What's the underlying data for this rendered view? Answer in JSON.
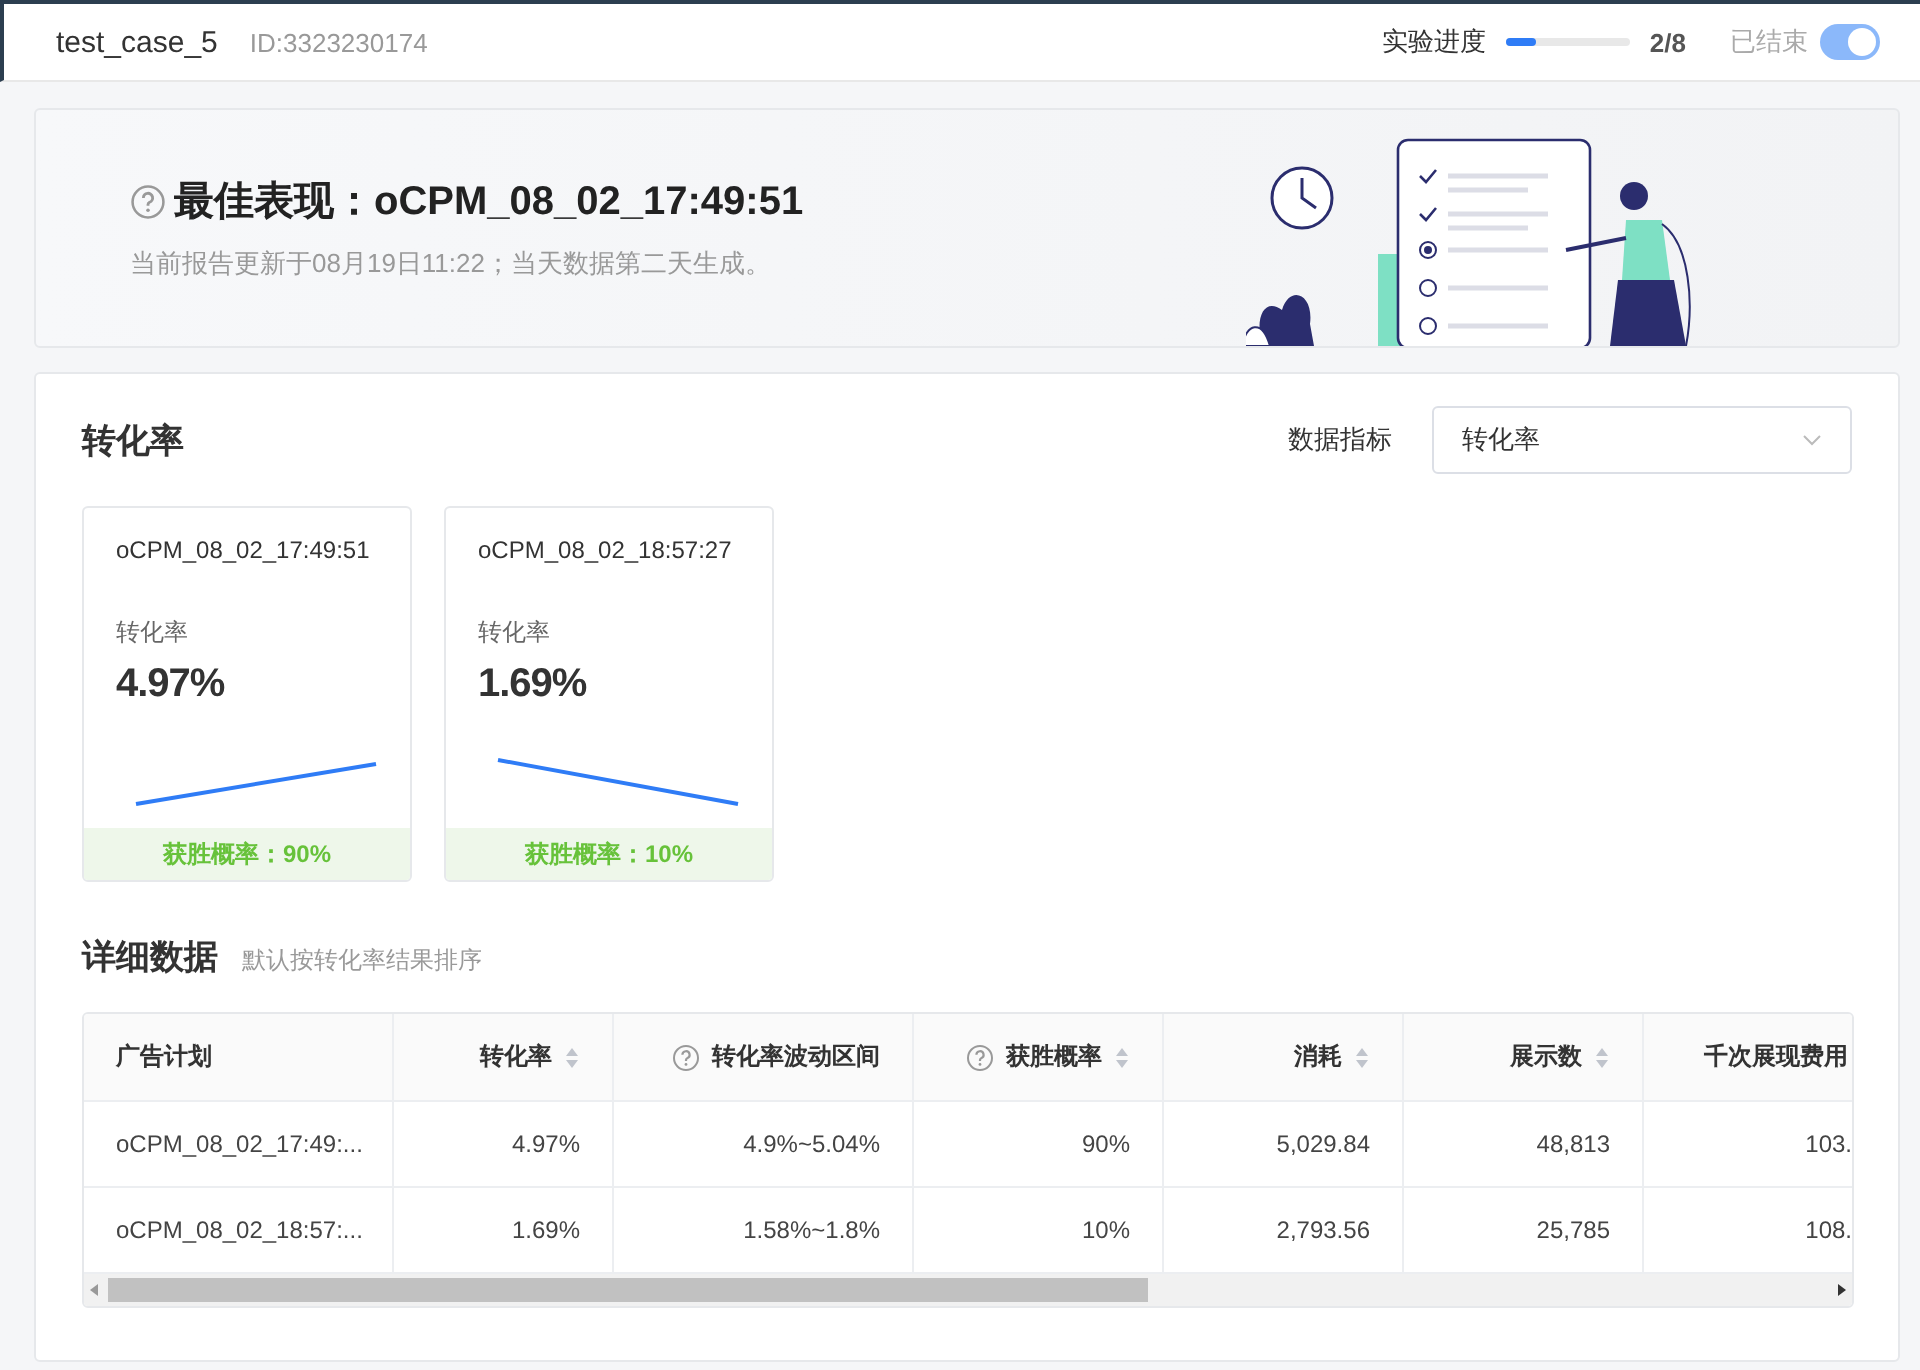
{
  "header": {
    "title": "test_case_5",
    "id": "ID:3323230174",
    "progress": {
      "label": "实验进度",
      "level": 0.25,
      "count": "2/8"
    },
    "toggle": {
      "label": "已结束",
      "on": true
    }
  },
  "banner": {
    "title": "最佳表现：oCPM_08_02_17:49:51",
    "subtitle": "当前报告更新于08月19日11:22；当天数据第二天生成。"
  },
  "metric_section": {
    "title": "转化率",
    "selector": {
      "label": "数据指标",
      "value": "转化率"
    },
    "cards": [
      {
        "name": "oCPM_08_02_17:49:51",
        "metric": "转化率",
        "value": "4.97%",
        "kind": "rising",
        "win": "获胜概率：90%"
      },
      {
        "name": "oCPM_08_02_18:57:27",
        "metric": "转化率",
        "value": "1.69%",
        "kind": "falling",
        "win": "获胜概率：10%"
      }
    ]
  },
  "detail": {
    "title": "详细数据",
    "note": "默认按转化率结果排序",
    "columns": [
      {
        "label": "广告计划",
        "help": false,
        "sortable": false
      },
      {
        "label": "转化率",
        "help": false,
        "sortable": true
      },
      {
        "label": "转化率波动区间",
        "help": true,
        "sortable": false
      },
      {
        "label": "获胜概率",
        "help": true,
        "sortable": true
      },
      {
        "label": "消耗",
        "help": false,
        "sortable": true
      },
      {
        "label": "展示数",
        "help": false,
        "sortable": true
      },
      {
        "label": "千次展现费用",
        "help": false,
        "sortable": false
      }
    ],
    "rows": [
      [
        "oCPM_08_02_17:49:...",
        "4.97%",
        "4.9%~5.04%",
        "90%",
        "5,029.84",
        "48,813",
        "103."
      ],
      [
        "oCPM_08_02_18:57:...",
        "1.69%",
        "1.58%~1.8%",
        "10%",
        "2,793.56",
        "25,785",
        "108."
      ]
    ]
  }
}
